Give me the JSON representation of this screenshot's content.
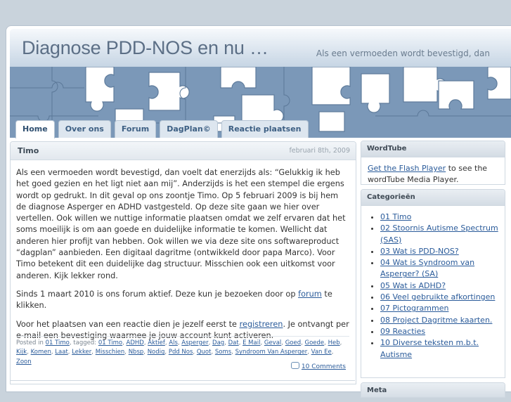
{
  "site": {
    "title": "Diagnose PDD-NOS en nu …",
    "description": "Als een vermoeden wordt bevestigd, dan"
  },
  "nav": {
    "tabs": [
      {
        "label": "Home",
        "active": true
      },
      {
        "label": "Over ons"
      },
      {
        "label": "Forum"
      },
      {
        "label": "DagPlan©"
      },
      {
        "label": "Reactie plaatsen"
      }
    ]
  },
  "post": {
    "title": "Timo",
    "date": "februari 8th, 2009",
    "paragraph1": "Als een vermoeden wordt bevestigd, dan voelt dat enerzijds als: “Gelukkig ik heb het goed gezien en het ligt niet aan mij”. Anderzijds is het een stempel die ergens wordt op gedrukt. In dit geval op ons zoontje Timo. Op 5 februari 2009 is bij hem de diagnose Asperger en ADHD vastgesteld. Op deze site gaan we hier over vertellen. Ook willen we nuttige informatie plaatsen omdat we zelf ervaren dat het soms moeilijk is om aan goede en duidelijke informatie te komen. Wellicht dat anderen hier profijt van hebben. Ook willen we via deze site ons softwareproduct “dagplan” aanbieden. Een digitaal dagritme (ontwikkeld door papa Marco). Voor Timo betekent dit een duidelijke dag structuur. Misschien ook een uitkomst voor anderen. Kijk lekker rond.",
    "paragraph2_before": "Sinds 1 maart 2010 is ons forum aktief. Deze kun je bezoeken door op ",
    "paragraph2_link": "forum",
    "paragraph2_after": " te klikken.",
    "paragraph3_before": "Voor het plaatsen van een reactie dien je jezelf eerst te ",
    "paragraph3_link": "registreren",
    "paragraph3_after": ". Je ontvangt per e-mail een bevestiging waarmee je jouw account kunt activeren.",
    "meta_prefix": "Posted in",
    "meta_category": "01 Timo",
    "meta_tagged": ", tagged:",
    "tags": [
      "01 Timo",
      "ADHD",
      "Aktief",
      "Als",
      "Asperger",
      "Dag",
      "Dat",
      "E Mail",
      "Geval",
      "Goed",
      "Goede",
      "Heb",
      "Kijk",
      "Komen",
      "Laat",
      "Lekker",
      "Misschien",
      "Nbsp",
      "Nodig",
      "Pdd Nos",
      "Quot",
      "Soms",
      "Syndroom Van Asperger",
      "Van Ee",
      "Zoon"
    ],
    "comments": "10 Comments"
  },
  "sidebar": {
    "wordtube": {
      "title": "WordTube",
      "link": "Get the Flash Player",
      "text": " to see the wordTube Media Player."
    },
    "categories": {
      "title": "Categorieën",
      "items": [
        "01 Timo",
        "02 Stoornis Autisme Spectrum (SAS)",
        "03 Wat is PDD-NOS?",
        "04 Wat is Syndroom van Asperger? (SA)",
        "05 Wat is ADHD?",
        "06 Veel gebruikte afkortingen",
        "07 Pictogrammen",
        "08 Project Dagritme kaarten.",
        "09 Reacties",
        "10 Diverse teksten m.b.t. Autisme"
      ]
    },
    "meta": {
      "title": "Meta"
    }
  },
  "colors": {
    "puzzle_blue": "#7b98b8",
    "puzzle_white": "#ffffff",
    "link": "#2a5b9a",
    "title": "#5c6f86"
  }
}
